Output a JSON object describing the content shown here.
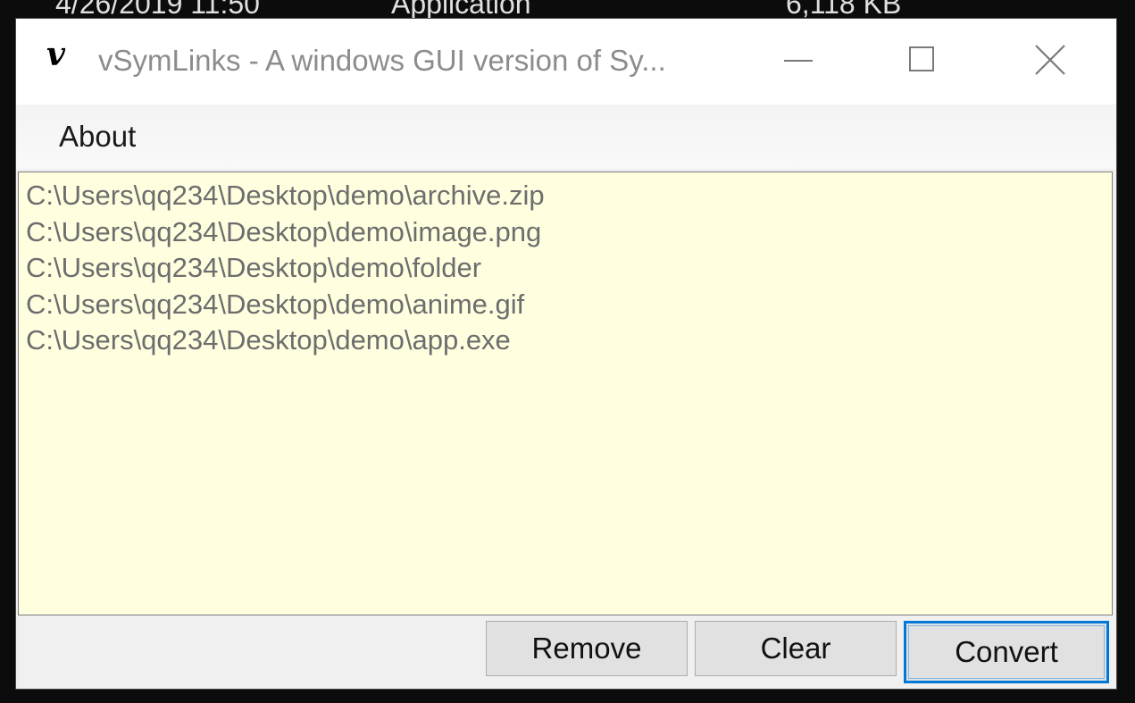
{
  "background": {
    "date": "4/26/2019 11:50",
    "type": "Application",
    "size": "6,118 KB"
  },
  "window": {
    "icon_letter": "v",
    "title": "vSymLinks - A windows GUI version of Sy...",
    "controls": [
      "minimize-icon",
      "maximize-icon",
      "close-icon"
    ]
  },
  "menu": {
    "items": [
      "About"
    ]
  },
  "files": [
    "C:\\Users\\qq234\\Desktop\\demo\\archive.zip",
    "C:\\Users\\qq234\\Desktop\\demo\\image.png",
    "C:\\Users\\qq234\\Desktop\\demo\\folder",
    "C:\\Users\\qq234\\Desktop\\demo\\anime.gif",
    "C:\\Users\\qq234\\Desktop\\demo\\app.exe"
  ],
  "buttons": {
    "remove": "Remove",
    "clear": "Clear",
    "convert": "Convert"
  },
  "colors": {
    "list_background": "#ffffe0",
    "focus_border": "#0078d7",
    "title_text": "#8c8c8c"
  }
}
